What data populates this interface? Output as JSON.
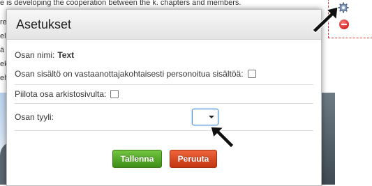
{
  "background": {
    "top_text": "e is developing the cooperation between the k. chapters and members.",
    "left_fragments": [
      "res",
      "els",
      "ä",
      "ek",
      "ehi"
    ]
  },
  "dialog": {
    "title": "Asetukset",
    "part_name_label": "Osan nimi:",
    "part_name_value": "Text",
    "personalized_label": "Osan sisältö on vastaanottajakohtaisesti personoitua sisältöä:",
    "hide_archive_label": "Piilota osa arkistosivulta:",
    "style_label": "Osan tyyli:",
    "style_value": "",
    "save_button": "Tallenna",
    "cancel_button": "Peruuta"
  },
  "colors": {
    "save": "#4aa321",
    "cancel": "#d9441a",
    "select_focus": "#4a90d9"
  }
}
